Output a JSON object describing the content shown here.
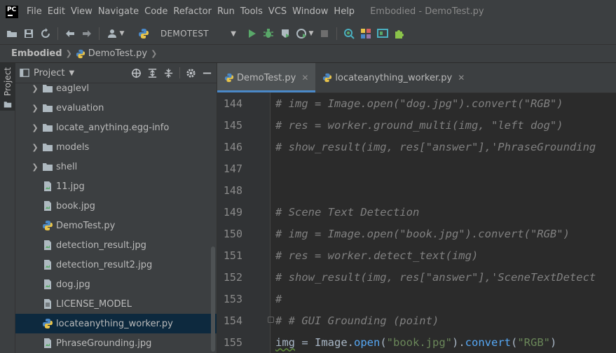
{
  "app": {
    "logo_text": "PC",
    "window_title": "Embodied - DemoTest.py"
  },
  "menu": [
    "File",
    "Edit",
    "View",
    "Navigate",
    "Code",
    "Refactor",
    "Run",
    "Tools",
    "VCS",
    "Window",
    "Help"
  ],
  "toolbar": {
    "run_config": "DEMOTEST"
  },
  "breadcrumb": {
    "root": "Embodied",
    "file": "DemoTest.py"
  },
  "side_stripe": {
    "project_tab": "Project"
  },
  "project_panel": {
    "title": "Project",
    "items": [
      {
        "label": "eaglevl",
        "type": "folder"
      },
      {
        "label": "evaluation",
        "type": "folder"
      },
      {
        "label": "locate_anything.egg-info",
        "type": "folder"
      },
      {
        "label": "models",
        "type": "folder"
      },
      {
        "label": "shell",
        "type": "folder"
      },
      {
        "label": "11.jpg",
        "type": "image"
      },
      {
        "label": "book.jpg",
        "type": "image"
      },
      {
        "label": "DemoTest.py",
        "type": "python"
      },
      {
        "label": "detection_result.jpg",
        "type": "image"
      },
      {
        "label": "detection_result2.jpg",
        "type": "image"
      },
      {
        "label": "dog.jpg",
        "type": "image"
      },
      {
        "label": "LICENSE_MODEL",
        "type": "text"
      },
      {
        "label": "locateanything_worker.py",
        "type": "python",
        "selected": true
      },
      {
        "label": "PhraseGrounding.jpg",
        "type": "image"
      }
    ]
  },
  "editor": {
    "tabs": [
      {
        "label": "DemoTest.py",
        "active": true
      },
      {
        "label": "locateanything_worker.py",
        "active": false
      }
    ],
    "lines": [
      {
        "num": "144",
        "text": "# img = Image.open(\"dog.jpg\").convert(\"RGB\")"
      },
      {
        "num": "145",
        "text": "# res = worker.ground_multi(img, \"left dog\")"
      },
      {
        "num": "146",
        "text": "# show_result(img, res[\"answer\"],'PhraseGrounding"
      },
      {
        "num": "147",
        "text": ""
      },
      {
        "num": "148",
        "text": ""
      },
      {
        "num": "149",
        "text": "# Scene Text Detection"
      },
      {
        "num": "150",
        "text": "# img = Image.open(\"book.jpg\").convert(\"RGB\")"
      },
      {
        "num": "151",
        "text": "# res = worker.detect_text(img)"
      },
      {
        "num": "152",
        "text": "# show_result(img, res[\"answer\"],'SceneTextDetect"
      },
      {
        "num": "153",
        "text": "#"
      },
      {
        "num": "154",
        "text": "# # GUI Grounding (point)"
      },
      {
        "num": "155",
        "text": ""
      }
    ],
    "line155": {
      "var": "img",
      "eq": " = ",
      "obj": "Image.",
      "fn1": "open",
      "p1": "(",
      "s1": "\"book.jpg\"",
      "p2": ").",
      "fn2": "convert",
      "p3": "(",
      "s2": "\"RGB\"",
      "p4": ")"
    }
  },
  "colors": {
    "accent": "#4a88c7",
    "selection": "#0d293e",
    "comment": "#808080",
    "string": "#6a8759",
    "function": "#56a8f5"
  }
}
